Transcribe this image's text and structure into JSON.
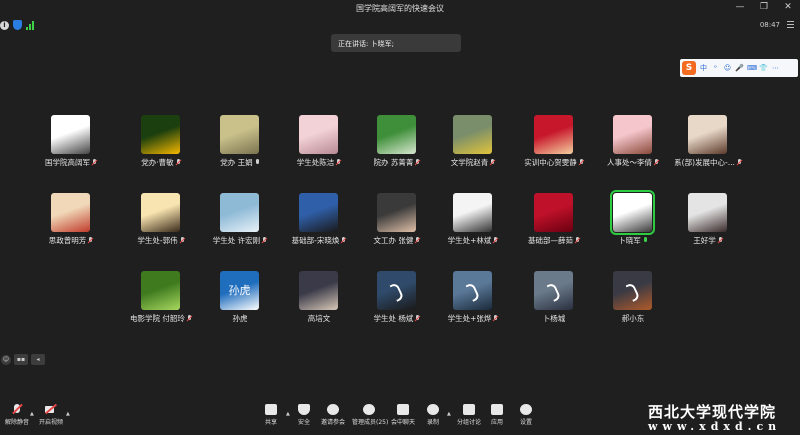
{
  "window": {
    "title": "国学院高阔军的快速会议",
    "controls": [
      "minimize-icon",
      "restore-icon",
      "close-icon"
    ]
  },
  "status": {
    "clock": "08:47",
    "info_icon": "i"
  },
  "speaking_banner": "正在讲话: 卜晓军;",
  "ime": {
    "logo": "S",
    "chinese_mode": "中",
    "items": [
      "中",
      "ᵒ",
      "☺",
      "🎤",
      "⌨",
      "👕",
      "⋯"
    ]
  },
  "participants": [
    {
      "name": "国学院高阔军",
      "mic": "muted",
      "avatar": "logo-icon",
      "colors": [
        "#ffffff",
        "#444444"
      ]
    },
    {
      "name": "党办·曹敏",
      "mic": "muted",
      "avatar": "flowers-photo",
      "colors": [
        "#1b3f0e",
        "#f6b800"
      ]
    },
    {
      "name": "党办 王娟",
      "mic": "on",
      "avatar": "desk-photo",
      "colors": [
        "#c9c08a",
        "#7a7450"
      ]
    },
    {
      "name": "学生处陈洁",
      "mic": "muted",
      "avatar": "girl-photo",
      "colors": [
        "#f2d2d6",
        "#b88a94"
      ]
    },
    {
      "name": "院办 苏菁菁",
      "mic": "muted",
      "avatar": "park-photo",
      "colors": [
        "#3f8f3a",
        "#d8e8d0"
      ]
    },
    {
      "name": "文学院赵青",
      "mic": "muted",
      "avatar": "kids-photo",
      "colors": [
        "#7a8e6b",
        "#e2c43a"
      ]
    },
    {
      "name": "实训中心贺雯静",
      "mic": "muted",
      "avatar": "newyear-art",
      "colors": [
        "#c7172b",
        "#f5d0a0"
      ]
    },
    {
      "name": "人事处～李倩",
      "mic": "muted",
      "avatar": "cartoon-girl",
      "colors": [
        "#f5c6cc",
        "#8a4a3a"
      ]
    },
    {
      "name": "系(部)发展中心-...",
      "mic": "muted",
      "avatar": "woman-photo",
      "colors": [
        "#e8d8c8",
        "#5b3a2a"
      ]
    },
    {
      "name": "思政曾明芳",
      "mic": "muted",
      "avatar": "couple-cartoon",
      "colors": [
        "#f0d8b8",
        "#c03a2a"
      ]
    },
    {
      "name": "学生处-郭伟",
      "mic": "muted",
      "avatar": "afro-cartoon",
      "colors": [
        "#f8e4b0",
        "#3a2a1a"
      ]
    },
    {
      "name": "学生处 许宏刚",
      "mic": "muted",
      "avatar": "sea-photo",
      "colors": [
        "#8fbad6",
        "#e8f2f8"
      ]
    },
    {
      "name": "基础部-宋晓焕",
      "mic": "muted",
      "avatar": "berries-photo",
      "colors": [
        "#2f5fa8",
        "#1a1a1a"
      ]
    },
    {
      "name": "文工办 张健",
      "mic": "muted",
      "avatar": "man-glasses",
      "colors": [
        "#3a3a3a",
        "#e0c0a8"
      ]
    },
    {
      "name": "学生处+林斌",
      "mic": "muted",
      "avatar": "couple-sketch",
      "colors": [
        "#f4f4f4",
        "#333333"
      ]
    },
    {
      "name": "基础部—薛茹",
      "mic": "muted",
      "avatar": "red-flower",
      "colors": [
        "#c0112a",
        "#6a0010"
      ]
    },
    {
      "name": "卜晓军",
      "mic": "green",
      "avatar": "forest-photo",
      "colors": [
        "#ffffff",
        "#3a3a3a"
      ],
      "active": true
    },
    {
      "name": "王好学",
      "mic": "muted",
      "avatar": "man-photo",
      "colors": [
        "#e4e4e4",
        "#3a2a2a"
      ]
    },
    {
      "name": "电影学院 付韶玲",
      "mic": "muted",
      "avatar": "leaf-photo",
      "colors": [
        "#3f7a1f",
        "#a8d860"
      ]
    },
    {
      "name": "孙虎",
      "mic": "none",
      "avatar": "text-avatar",
      "colors": [
        "#1f6dbd",
        "#ffffff"
      ],
      "avatar_text": "孙虎"
    },
    {
      "name": "高培文",
      "mic": "none",
      "avatar": "office-photo",
      "colors": [
        "#3a3a48",
        "#d8c8b8"
      ]
    },
    {
      "name": "学生处 杨斌",
      "mic": "muted",
      "avatar": "phone-icon",
      "colors": [
        "#2f4a6a",
        "#1a1a1a"
      ]
    },
    {
      "name": "学生处+张烨",
      "mic": "muted",
      "avatar": "phone-icon",
      "colors": [
        "#5a7898",
        "#1a2a3a"
      ]
    },
    {
      "name": "卜杨城",
      "mic": "none",
      "avatar": "phone-icon",
      "colors": [
        "#6a7a8a",
        "#2a3040"
      ]
    },
    {
      "name": "郝小东",
      "mic": "none",
      "avatar": "phone-icon",
      "colors": [
        "#3a3a44",
        "#b05a2a"
      ]
    }
  ],
  "left_tools": [
    "emoji-icon",
    "chat-icon",
    "collapse-icon"
  ],
  "toolbar": {
    "unmute": "解除静音",
    "start_video": "开启视频",
    "share": "共享",
    "security": "安全",
    "invite": "邀请参会",
    "participants": "管理成员(25)",
    "chat": "会中聊天",
    "record": "录制",
    "breakout": "分组讨论",
    "apps": "应用",
    "settings": "设置"
  },
  "watermark": {
    "text": "西北大学现代学院",
    "url": "www.xdxd.cn"
  }
}
